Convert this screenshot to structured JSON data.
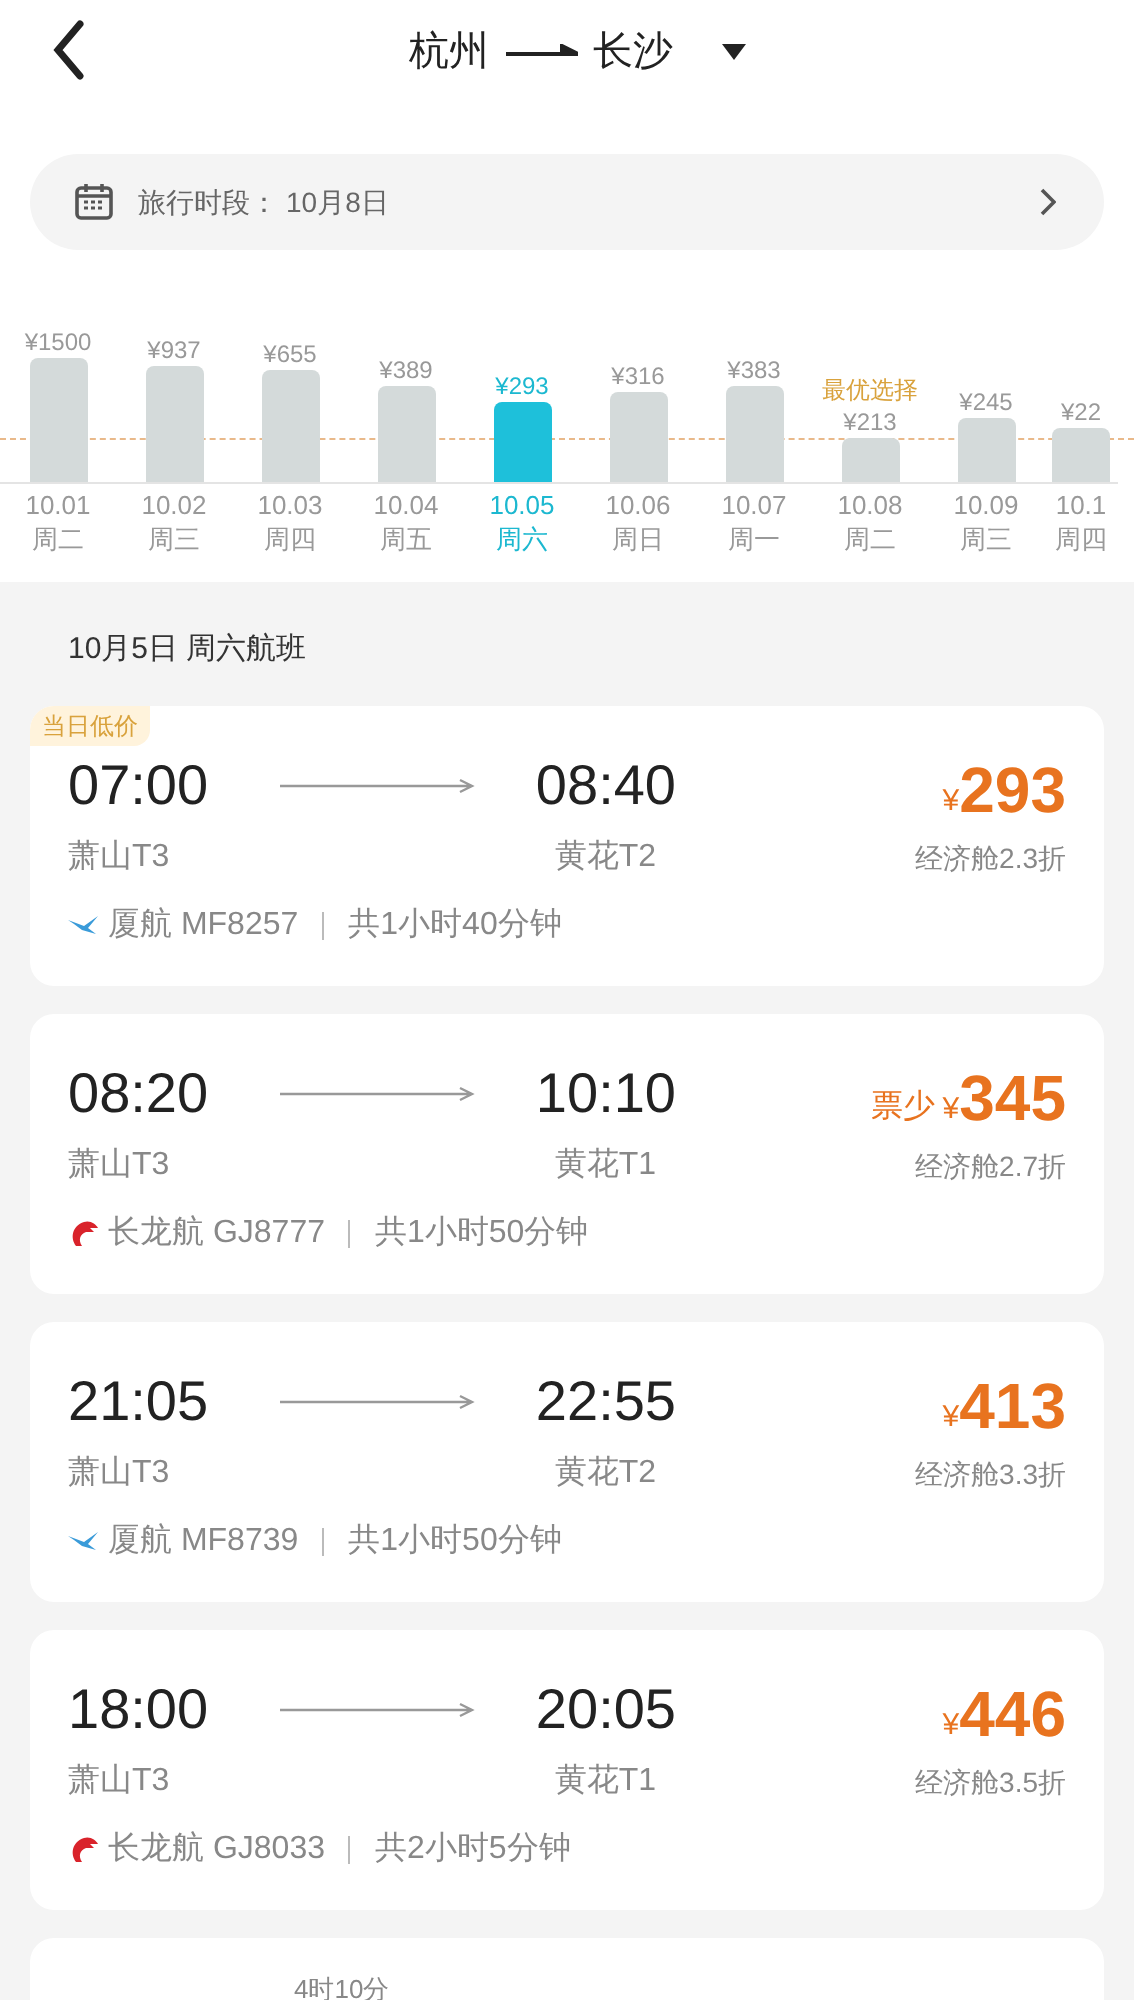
{
  "header": {
    "from": "杭州",
    "to": "长沙"
  },
  "travel_period": {
    "label": "旅行时段：",
    "value": "10月8日"
  },
  "days": [
    {
      "price": "¥1500",
      "date": "10.01",
      "weekday": "周二",
      "selected": false
    },
    {
      "price": "¥937",
      "date": "10.02",
      "weekday": "周三",
      "selected": false
    },
    {
      "price": "¥655",
      "date": "10.03",
      "weekday": "周四",
      "selected": false
    },
    {
      "price": "¥389",
      "date": "10.04",
      "weekday": "周五",
      "selected": false
    },
    {
      "price": "¥293",
      "date": "10.05",
      "weekday": "周六",
      "selected": true
    },
    {
      "price": "¥316",
      "date": "10.06",
      "weekday": "周日",
      "selected": false
    },
    {
      "price": "¥383",
      "date": "10.07",
      "weekday": "周一",
      "selected": false
    },
    {
      "price": "¥213",
      "date": "10.08",
      "weekday": "周二",
      "selected": false,
      "tag": "最优选择"
    },
    {
      "price": "¥245",
      "date": "10.09",
      "weekday": "周三",
      "selected": false
    },
    {
      "price": "¥22",
      "date": "10.1",
      "weekday": "周四",
      "selected": false
    }
  ],
  "section_title": "10月5日 周六航班",
  "flights": [
    {
      "badge": "当日低价",
      "depart": "07:00",
      "arrive": "08:40",
      "from_terminal": "萧山T3",
      "to_terminal": "黄花T2",
      "price": "293",
      "currency": "¥",
      "cabin": "经济舱2.3折",
      "kind": "bird",
      "airline": "厦航 MF8257",
      "duration": "共1小时40分钟"
    },
    {
      "note": "票少",
      "depart": "08:20",
      "arrive": "10:10",
      "from_terminal": "萧山T3",
      "to_terminal": "黄花T1",
      "price": "345",
      "currency": "¥",
      "cabin": "经济舱2.7折",
      "kind": "dragon",
      "airline": "长龙航 GJ8777",
      "duration": "共1小时50分钟"
    },
    {
      "depart": "21:05",
      "arrive": "22:55",
      "from_terminal": "萧山T3",
      "to_terminal": "黄花T2",
      "price": "413",
      "currency": "¥",
      "cabin": "经济舱3.3折",
      "kind": "bird",
      "airline": "厦航 MF8739",
      "duration": "共1小时50分钟"
    },
    {
      "depart": "18:00",
      "arrive": "20:05",
      "from_terminal": "萧山T3",
      "to_terminal": "黄花T1",
      "price": "446",
      "currency": "¥",
      "cabin": "经济舱3.5折",
      "kind": "dragon",
      "airline": "长龙航 GJ8033",
      "duration": "共2小时5分钟"
    }
  ],
  "partial_card": {
    "duration": "4时10分"
  }
}
